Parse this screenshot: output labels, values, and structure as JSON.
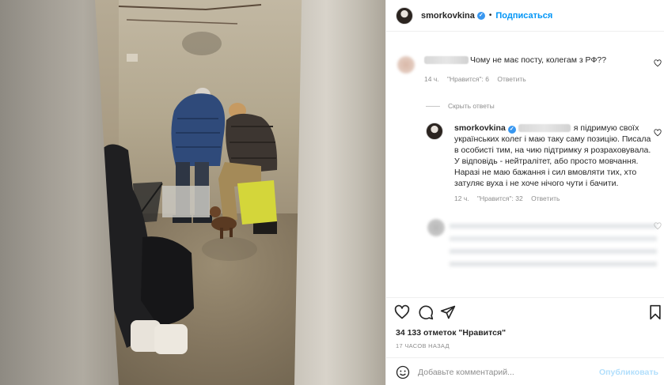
{
  "post": {
    "username": "smorkovkina",
    "follow_label": "Подписаться",
    "dot": "•"
  },
  "comments": [
    {
      "text": "Чому не має посту, колегам з РФ??",
      "time": "14 ч.",
      "likes": "\"Нравится\": 6",
      "reply_label": "Ответить"
    }
  ],
  "hide_replies_label": "Скрыть ответы",
  "reply": {
    "username": "smorkovkina",
    "lines": [
      "я підримую своїх",
      "українських колег і маю таку саму позицію. Писала",
      "в особисті тим, на чию підтримку я розраховувала.",
      "У відповідь - нейтралітет, або просто мовчання.",
      "Наразі не маю бажання і сил вмовляти тих, хто",
      "затуляє вуха і не хоче нічого чути і бачити."
    ],
    "time": "12 ч.",
    "likes": "\"Нравится\": 32",
    "reply_label": "Ответить"
  },
  "likes_count": "34 133 отметок \"Нравится\"",
  "time_ago": "17 ЧАСОВ НАЗАД",
  "comment_input": {
    "placeholder": "Добавьте комментарий...",
    "post_label": "Опубликовать"
  },
  "icons": {
    "like": "heart-icon",
    "comment": "comment-icon",
    "share": "paper-plane-icon",
    "save": "bookmark-icon",
    "emoji": "smiley-icon",
    "verified": "verified-badge-icon"
  },
  "colors": {
    "accent": "#0095f6",
    "verified": "#3897f0",
    "muted_text": "#8e8e8e",
    "post_button_disabled": "#b2dffc"
  }
}
